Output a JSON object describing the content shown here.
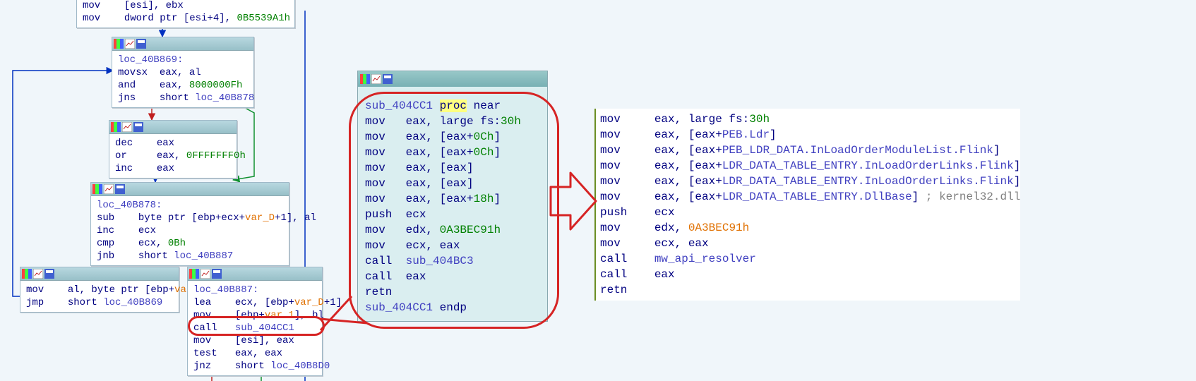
{
  "left_graph": {
    "node_top": {
      "lines": [
        {
          "m": "mov",
          "ops": "[esi], ebx"
        },
        {
          "m": "mov",
          "ops": "dword ptr [esi+4], ",
          "imm": "0B5539A1h"
        }
      ]
    },
    "node_40B869": {
      "label": "loc_40B869:",
      "lines": [
        {
          "m": "movsx",
          "ops": "eax, al"
        },
        {
          "m": "and",
          "ops": "eax, ",
          "imm": "8000000Fh"
        },
        {
          "m": "jns",
          "ops": "short ",
          "ref": "loc_40B878"
        }
      ]
    },
    "node_dec": {
      "lines": [
        {
          "m": "dec",
          "ops": "eax"
        },
        {
          "m": "or",
          "ops": "eax, ",
          "imm": "0FFFFFFF0h"
        },
        {
          "m": "inc",
          "ops": "eax"
        }
      ]
    },
    "node_40B878": {
      "label": "loc_40B878:",
      "lines": [
        {
          "m": "sub",
          "ops": "byte ptr [ebp+ecx+",
          "var": "var_D",
          "ops2": "+1], al"
        },
        {
          "m": "inc",
          "ops": "ecx"
        },
        {
          "m": "cmp",
          "ops": "ecx, ",
          "imm": "0Bh"
        },
        {
          "m": "jnb",
          "ops": "short ",
          "ref": "loc_40B887"
        }
      ]
    },
    "node_left_small": {
      "lines": [
        {
          "m": "mov",
          "ops": "al, byte ptr [ebp+",
          "var": "var_D",
          "ops2": "]"
        },
        {
          "m": "jmp",
          "ops": "short ",
          "ref": "loc_40B869"
        }
      ]
    },
    "node_40B887": {
      "label": "loc_40B887:",
      "lines": [
        {
          "m": "lea",
          "ops": "ecx, [ebp+",
          "var": "var_D",
          "ops2": "+1]"
        },
        {
          "m": "mov",
          "ops": "[ebp+",
          "var": "var 1",
          "ops2": "], bl"
        },
        {
          "m": "call",
          "ops": "",
          "ref": "sub_404CC1"
        },
        {
          "m": "mov",
          "ops": "[esi], eax"
        },
        {
          "m": "test",
          "ops": "eax, eax"
        },
        {
          "m": "jnz",
          "ops": "short ",
          "ref": "loc_40B8D0"
        }
      ]
    }
  },
  "center_node": {
    "head": {
      "name": "sub_404CC1",
      "proc": "proc",
      "near": "near"
    },
    "lines": [
      {
        "m": "mov",
        "ops": "eax, large fs:",
        "imm": "30h"
      },
      {
        "m": "mov",
        "ops": "eax, [eax+",
        "imm": "0Ch",
        "ops2": "]"
      },
      {
        "m": "mov",
        "ops": "eax, [eax+",
        "imm": "0Ch",
        "ops2": "]"
      },
      {
        "m": "mov",
        "ops": "eax, [eax]"
      },
      {
        "m": "mov",
        "ops": "eax, [eax]"
      },
      {
        "m": "mov",
        "ops": "eax, [eax+",
        "imm": "18h",
        "ops2": "]"
      },
      {
        "m": "push",
        "ops": "ecx"
      },
      {
        "m": "mov",
        "ops": "edx, ",
        "imm": "0A3BEC91h"
      },
      {
        "m": "mov",
        "ops": "ecx, eax"
      },
      {
        "m": "call",
        "ops": "",
        "ref": "sub_404BC3"
      },
      {
        "m": "call",
        "ops": "eax"
      },
      {
        "m": "retn",
        "ops": ""
      }
    ],
    "tail": {
      "name": "sub_404CC1",
      "endp": "endp"
    }
  },
  "decoded": {
    "lines": [
      {
        "m": "mov",
        "ops": "eax, large fs:",
        "imm": "30h"
      },
      {
        "m": "mov",
        "ops": "eax, [eax+",
        "sym": "PEB.Ldr",
        "ops2": "]"
      },
      {
        "m": "mov",
        "ops": "eax, [eax+",
        "sym": "PEB_LDR_DATA.InLoadOrderModuleList.Flink",
        "ops2": "]"
      },
      {
        "m": "mov",
        "ops": "eax, [eax+",
        "sym": "LDR_DATA_TABLE_ENTRY.InLoadOrderLinks.Flink",
        "ops2": "]"
      },
      {
        "m": "mov",
        "ops": "eax, [eax+",
        "sym": "LDR_DATA_TABLE_ENTRY.InLoadOrderLinks.Flink",
        "ops2": "]"
      },
      {
        "m": "mov",
        "ops": "eax, [eax+",
        "sym": "LDR_DATA_TABLE_ENTRY.DllBase",
        "ops2": "] ",
        "cmt": "; kernel32.dll"
      },
      {
        "m": "push",
        "ops": "ecx"
      },
      {
        "m": "mov",
        "ops": "edx, ",
        "orange": "0A3BEC91h"
      },
      {
        "m": "mov",
        "ops": "ecx, eax"
      },
      {
        "m": "call",
        "ops": "",
        "ref": "mw_api_resolver"
      },
      {
        "m": "call",
        "ops": "eax"
      },
      {
        "m": "retn",
        "ops": ""
      }
    ]
  }
}
